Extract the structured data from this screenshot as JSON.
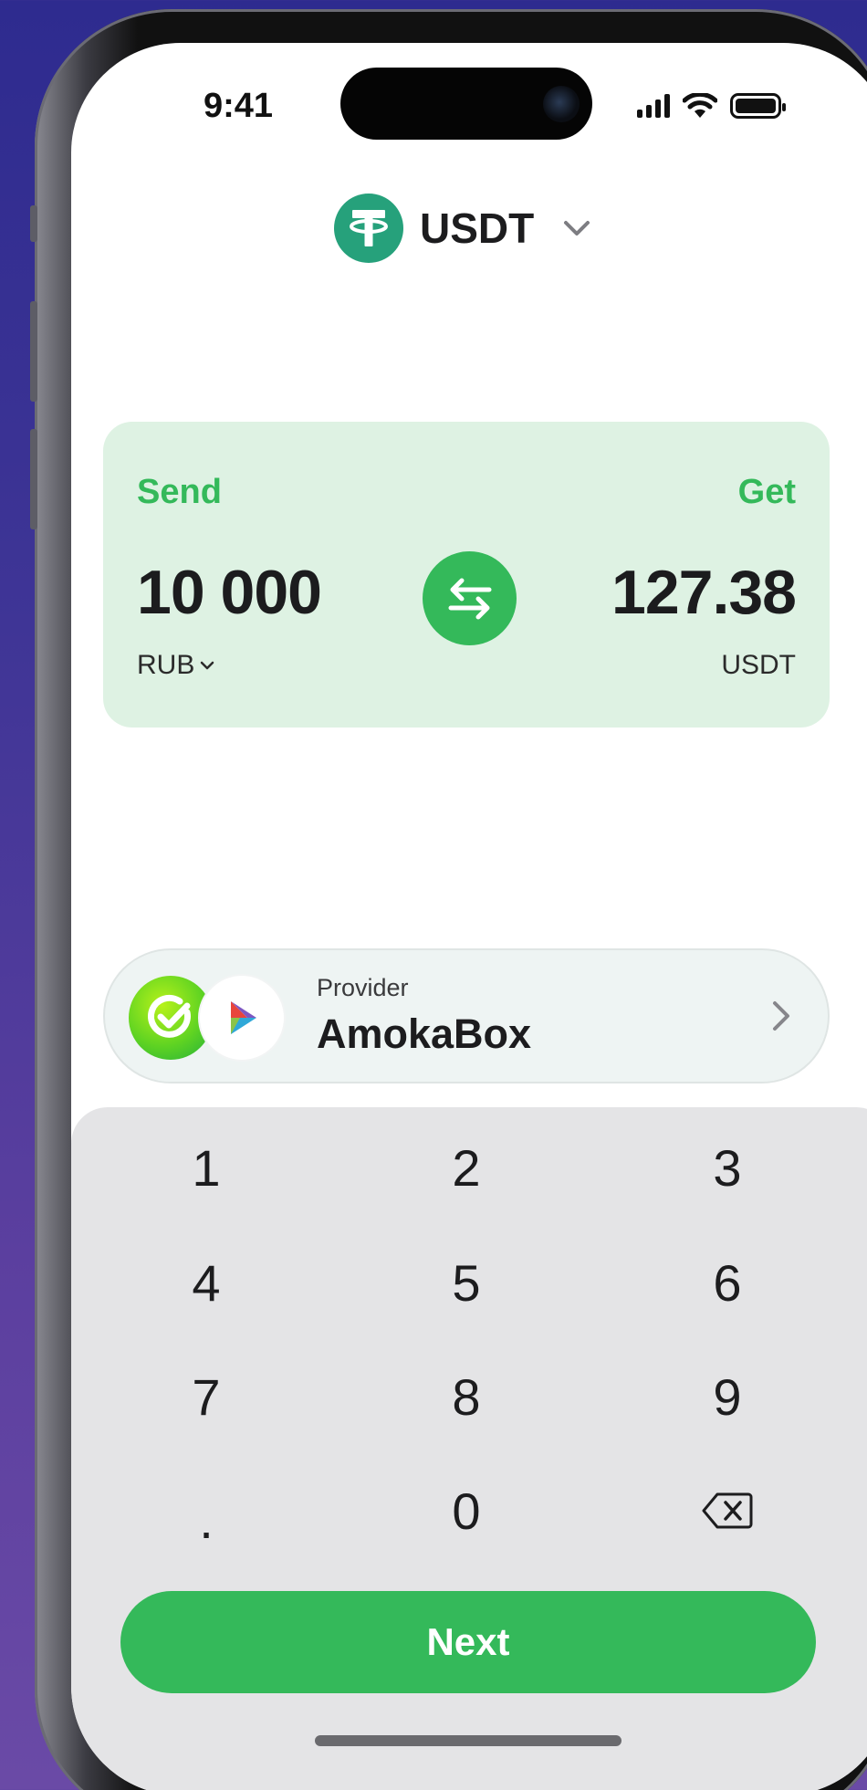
{
  "status_bar": {
    "time": "9:41"
  },
  "header": {
    "asset_symbol": "USDT",
    "asset_icon": "tether-icon"
  },
  "exchange": {
    "send_label": "Send",
    "get_label": "Get",
    "send_amount": "10 000",
    "get_amount": "127.38",
    "send_currency": "RUB",
    "get_currency": "USDT"
  },
  "provider": {
    "caption": "Provider",
    "name": "AmokaBox"
  },
  "keypad": {
    "keys": [
      "1",
      "2",
      "3",
      "4",
      "5",
      "6",
      "7",
      "8",
      "9",
      ".",
      "0"
    ]
  },
  "actions": {
    "next_label": "Next"
  },
  "colors": {
    "accent": "#34b95a",
    "card_background": "#def2e3",
    "tether": "#26a17b",
    "keypad_background": "#e4e4e6"
  }
}
